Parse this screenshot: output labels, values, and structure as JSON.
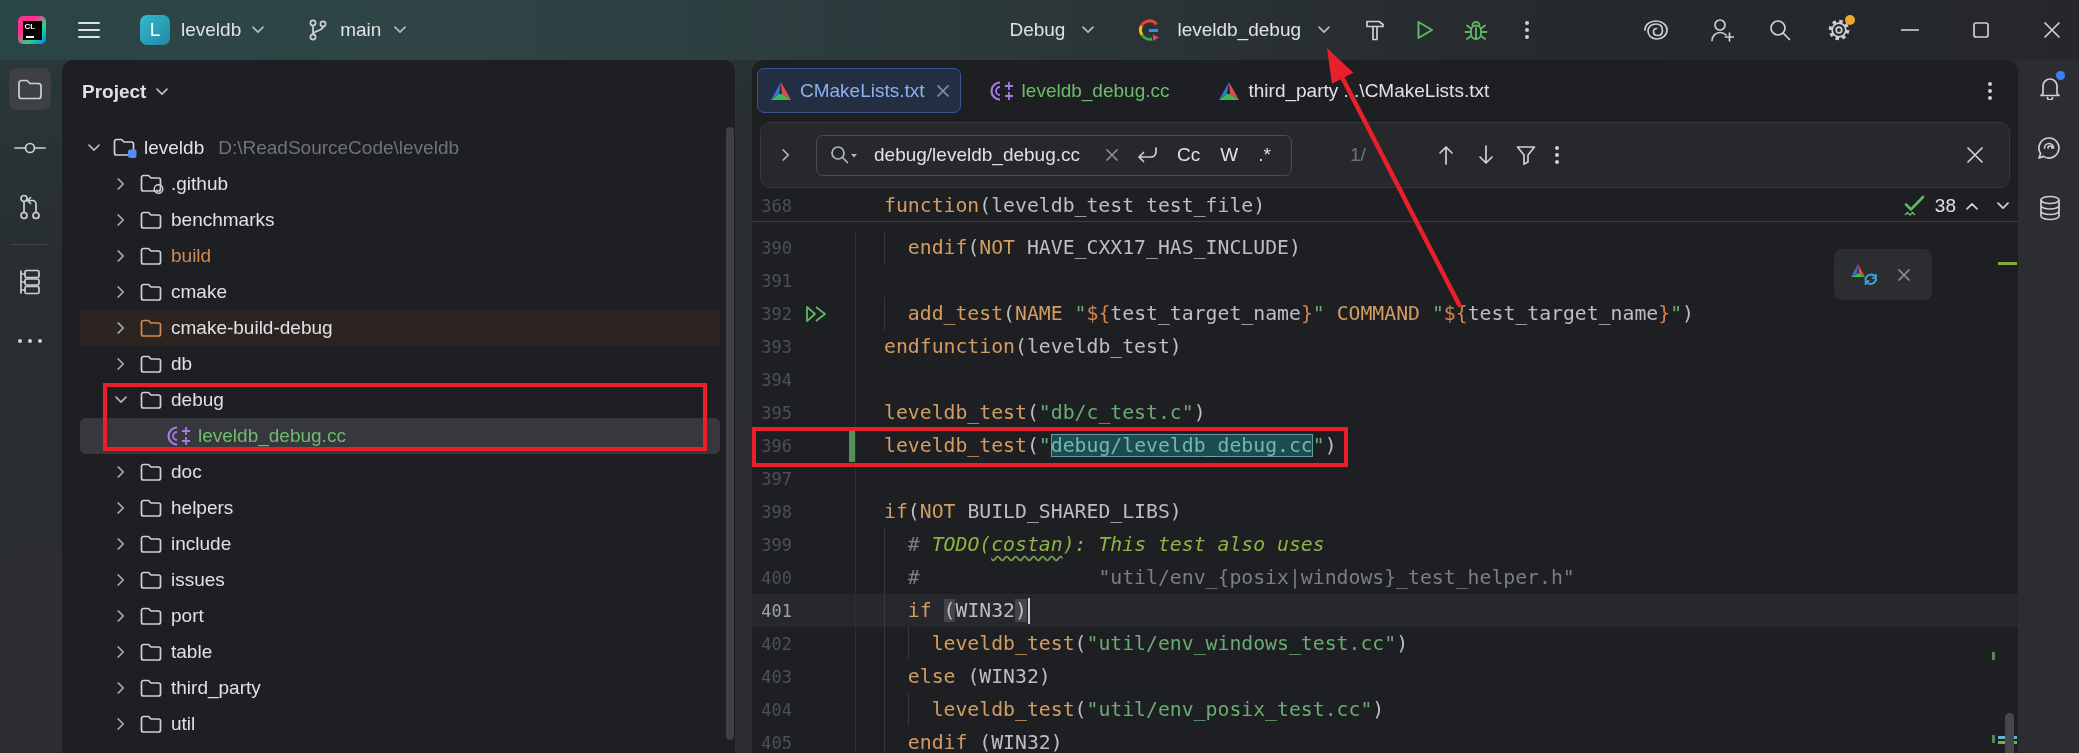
{
  "title_bar": {
    "logo": "CL",
    "project": {
      "initial": "L",
      "name": "leveldb"
    },
    "branch": "main",
    "build_type": "Debug",
    "run_config": {
      "name": "leveldb_debug",
      "arrow_target": true
    },
    "settings_badge": true
  },
  "left_toolbar": {
    "groups": [
      [
        {
          "kind": "project",
          "selected": true
        },
        {
          "kind": "commit",
          "selected": false
        },
        {
          "kind": "pull-requests",
          "selected": false
        }
      ],
      [
        {
          "kind": "structure",
          "selected": false
        },
        {
          "kind": "more",
          "selected": false
        }
      ]
    ]
  },
  "project_panel": {
    "title": "Project",
    "tree": [
      {
        "name": "leveldb",
        "path": "D:\\ReadSourceCode\\leveldb",
        "kind": "module",
        "expanded": true,
        "selected": false,
        "children": [
          {
            "name": ".github",
            "kind": "github-folder",
            "expanded": false,
            "selected": false
          },
          {
            "name": "benchmarks",
            "kind": "folder",
            "expanded": false,
            "selected": false
          },
          {
            "name": "build",
            "kind": "folder",
            "expanded": false,
            "selected": false,
            "ignored": true
          },
          {
            "name": "cmake",
            "kind": "folder",
            "expanded": false,
            "selected": false
          },
          {
            "name": "cmake-build-debug",
            "kind": "excluded-folder",
            "expanded": false,
            "selected": false
          },
          {
            "name": "db",
            "kind": "folder",
            "expanded": false,
            "selected": false
          },
          {
            "name": "debug",
            "kind": "folder",
            "expanded": true,
            "selected": false,
            "outlined": true,
            "children": [
              {
                "name": "leveldb_debug.cc",
                "kind": "cpp-file",
                "selected": true,
                "added": true
              }
            ]
          },
          {
            "name": "doc",
            "kind": "folder",
            "expanded": false,
            "selected": false
          },
          {
            "name": "helpers",
            "kind": "folder",
            "expanded": false,
            "selected": false
          },
          {
            "name": "include",
            "kind": "folder",
            "expanded": false,
            "selected": false
          },
          {
            "name": "issues",
            "kind": "folder",
            "expanded": false,
            "selected": false
          },
          {
            "name": "port",
            "kind": "folder",
            "expanded": false,
            "selected": false
          },
          {
            "name": "table",
            "kind": "folder",
            "expanded": false,
            "selected": false
          },
          {
            "name": "third_party",
            "kind": "folder",
            "expanded": false,
            "selected": false
          },
          {
            "name": "util",
            "kind": "folder",
            "expanded": false,
            "selected": false
          }
        ]
      }
    ]
  },
  "editor": {
    "tabs": [
      {
        "label": "CMakeLists.txt",
        "kind": "cmake",
        "selected": true
      },
      {
        "label": "leveldb_debug.cc",
        "kind": "cpp",
        "selected": false,
        "added": true
      },
      {
        "label": "third_party ...\\CMakeLists.txt",
        "kind": "cmake",
        "selected": false
      }
    ],
    "search": {
      "query": "debug/leveldb_debug.cc",
      "options": [
        {
          "label": "Cc",
          "on": false
        },
        {
          "label": "W",
          "on": false
        },
        {
          "label": ".*",
          "on": false
        }
      ],
      "result": "1/"
    },
    "sticky_line": {
      "number": "368",
      "tokens": [
        {
          "text": "function",
          "kind": "keyword"
        },
        {
          "text": "(leveldb_test test_file)",
          "kind": "plain"
        }
      ]
    },
    "inspections": {
      "count": "38"
    },
    "reload_popup": true,
    "lines": [
      {
        "number": "390",
        "tokens": [
          {
            "text": "  endif",
            "kind": "keyword"
          },
          {
            "text": "(",
            "kind": "plain"
          },
          {
            "text": "NOT",
            "kind": "keyword"
          },
          {
            "text": " HAVE_CXX17_HAS_INCLUDE)",
            "kind": "plain"
          }
        ]
      },
      {
        "number": "391"
      },
      {
        "number": "392",
        "runnable": true,
        "arrow_source": true,
        "tokens": [
          {
            "text": "  add_test",
            "kind": "keyword"
          },
          {
            "text": "(",
            "kind": "plain"
          },
          {
            "text": "NAME",
            "kind": "keyword"
          },
          {
            "text": " \"",
            "kind": "string"
          },
          {
            "text": "${",
            "kind": "interp"
          },
          {
            "text": "test_target_name",
            "kind": "plain"
          },
          {
            "text": "}",
            "kind": "interp"
          },
          {
            "text": "\"",
            "kind": "string"
          },
          {
            "text": " COMMAND",
            "kind": "keyword"
          },
          {
            "text": " \"",
            "kind": "string"
          },
          {
            "text": "${",
            "kind": "interp"
          },
          {
            "text": "test_target_name",
            "kind": "plain"
          },
          {
            "text": "}",
            "kind": "interp"
          },
          {
            "text": "\"",
            "kind": "string"
          },
          {
            "text": ")",
            "kind": "plain"
          }
        ]
      },
      {
        "number": "393",
        "tokens": [
          {
            "text": "endfunction",
            "kind": "keyword"
          },
          {
            "text": "(leveldb_test)",
            "kind": "plain"
          }
        ]
      },
      {
        "number": "394"
      },
      {
        "number": "395",
        "tokens": [
          {
            "text": "leveldb_test",
            "kind": "keyword"
          },
          {
            "text": "(",
            "kind": "plain"
          },
          {
            "text": "\"db/c_test.c\"",
            "kind": "string"
          },
          {
            "text": ")",
            "kind": "plain"
          }
        ]
      },
      {
        "number": "396",
        "modified": true,
        "outlined": true,
        "tokens": [
          {
            "text": "leveldb_test",
            "kind": "keyword"
          },
          {
            "text": "(",
            "kind": "plain"
          },
          {
            "text": "\"",
            "kind": "string"
          },
          {
            "text": "debug/leveldb_debug.cc",
            "kind": "match"
          },
          {
            "text": "\"",
            "kind": "string"
          },
          {
            "text": ")",
            "kind": "plain"
          }
        ]
      },
      {
        "number": "397"
      },
      {
        "number": "398",
        "tokens": [
          {
            "text": "if",
            "kind": "keyword"
          },
          {
            "text": "(",
            "kind": "plain"
          },
          {
            "text": "NOT",
            "kind": "keyword"
          },
          {
            "text": " BUILD_SHARED_LIBS)",
            "kind": "plain"
          }
        ]
      },
      {
        "number": "399",
        "tokens": [
          {
            "text": "  # ",
            "kind": "comment"
          },
          {
            "text": "TODO(",
            "kind": "todo"
          },
          {
            "text": "costan",
            "kind": "typo"
          },
          {
            "text": "): This test also uses",
            "kind": "todo"
          }
        ]
      },
      {
        "number": "400",
        "tokens": [
          {
            "text": "  #               \"util/env_{posix|windows}_test_helper.h\"",
            "kind": "comment"
          }
        ]
      },
      {
        "number": "401",
        "current": true,
        "tokens": [
          {
            "text": "  if ",
            "kind": "keyword"
          },
          {
            "text": "(",
            "kind": "brace"
          },
          {
            "text": "WIN32",
            "kind": "plain"
          },
          {
            "text": ")",
            "kind": "brace"
          }
        ]
      },
      {
        "number": "402",
        "tokens": [
          {
            "text": "    leveldb_test",
            "kind": "keyword"
          },
          {
            "text": "(",
            "kind": "plain"
          },
          {
            "text": "\"util/env_windows_test.cc\"",
            "kind": "string"
          },
          {
            "text": ")",
            "kind": "plain"
          }
        ]
      },
      {
        "number": "403",
        "tokens": [
          {
            "text": "  else",
            "kind": "keyword"
          },
          {
            "text": " (WIN32)",
            "kind": "plain"
          }
        ]
      },
      {
        "number": "404",
        "tokens": [
          {
            "text": "    leveldb_test",
            "kind": "keyword"
          },
          {
            "text": "(",
            "kind": "plain"
          },
          {
            "text": "\"util/env_posix_test.cc\"",
            "kind": "string"
          },
          {
            "text": ")",
            "kind": "plain"
          }
        ]
      },
      {
        "number": "405",
        "tokens": [
          {
            "text": "  endif",
            "kind": "keyword"
          },
          {
            "text": " (WIN32)",
            "kind": "plain"
          }
        ]
      }
    ]
  },
  "right_toolbar": [
    {
      "kind": "notifications",
      "badge": true
    },
    {
      "kind": "ai-chat",
      "badge": false
    },
    {
      "kind": "database",
      "badge": false
    }
  ]
}
